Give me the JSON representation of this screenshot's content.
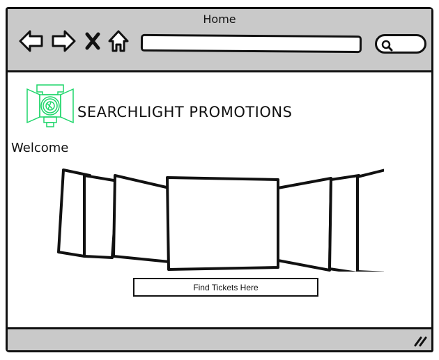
{
  "window": {
    "title": "Home"
  },
  "toolbar": {
    "back_icon": "arrow-left-icon",
    "forward_icon": "arrow-right-icon",
    "stop_icon": "close-icon",
    "home_icon": "home-icon",
    "address_value": "",
    "search_value": "",
    "search_icon": "search-icon"
  },
  "header": {
    "brand": "SEARCHLIGHT PROMOTIONS",
    "logo_color": "#1ed66a"
  },
  "main": {
    "welcome": "Welcome",
    "carousel_slide_count": 7,
    "cta_label": "Find Tickets Here"
  },
  "colors": {
    "chrome": "#c9c9c9",
    "ink": "#111111",
    "logo": "#1ed66a"
  }
}
